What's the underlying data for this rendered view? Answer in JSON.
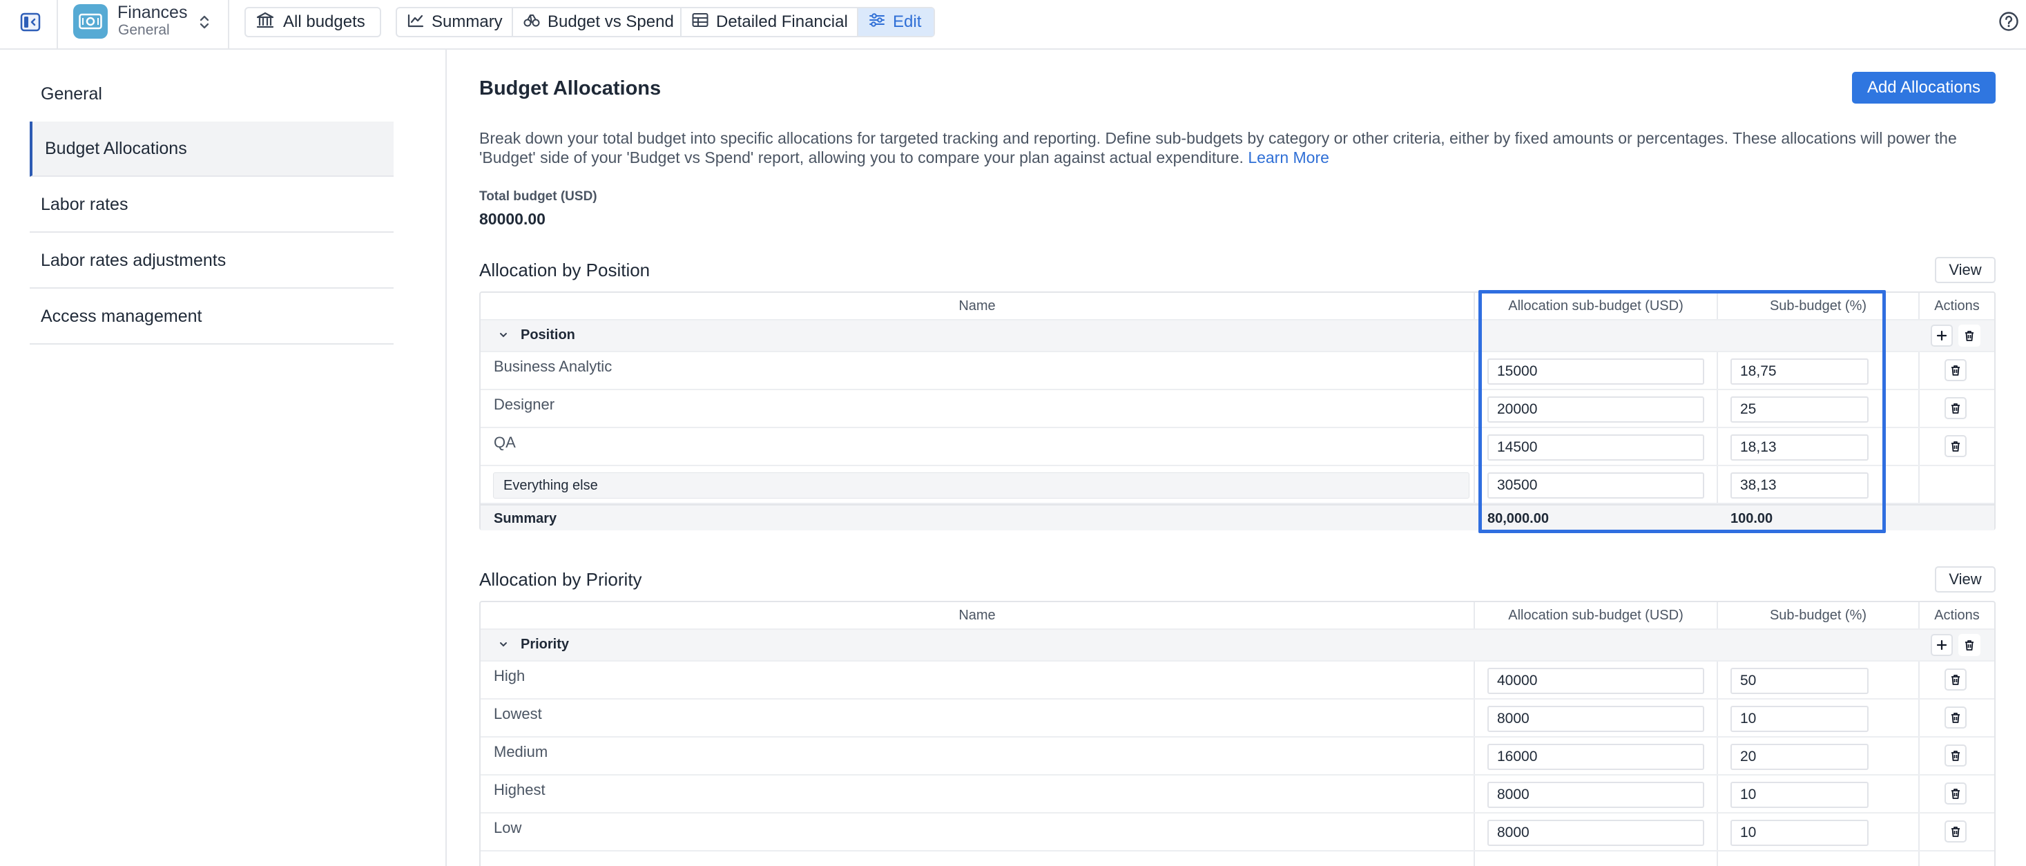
{
  "header": {
    "app_name": "Finances",
    "app_sub": "General",
    "all_budgets": "All budgets",
    "tabs": [
      {
        "label": "Summary",
        "icon": "chart-icon"
      },
      {
        "label": "Budget vs Spend",
        "icon": "scale-icon"
      },
      {
        "label": "Detailed Financial",
        "icon": "table-icon"
      },
      {
        "label": "Edit",
        "icon": "sliders-icon",
        "active": true
      }
    ]
  },
  "sidebar": {
    "items": [
      {
        "label": "General"
      },
      {
        "label": "Budget Allocations",
        "active": true
      },
      {
        "label": "Labor rates"
      },
      {
        "label": "Labor rates adjustments"
      },
      {
        "label": "Access management"
      }
    ]
  },
  "page": {
    "title": "Budget Allocations",
    "add_button": "Add Allocations",
    "description": "Break down your total budget into specific allocations for targeted tracking and reporting. Define sub-budgets by category or other criteria, either by fixed amounts or percentages. These allocations will power the 'Budget' side of your 'Budget vs Spend' report, allowing you to compare your plan against actual expenditure.",
    "learn_more": "Learn More",
    "total_label": "Total budget (USD)",
    "total_value": "80000.00"
  },
  "columns": {
    "name": "Name",
    "usd": "Allocation sub-budget (USD)",
    "pct": "Sub-budget (%)",
    "actions": "Actions"
  },
  "position": {
    "title": "Allocation by Position",
    "view": "View",
    "group": "Position",
    "rows": [
      {
        "name": "Business Analytic",
        "usd": "15000",
        "pct": "18,75"
      },
      {
        "name": "Designer",
        "usd": "20000",
        "pct": "25"
      },
      {
        "name": "QA",
        "usd": "14500",
        "pct": "18,13"
      }
    ],
    "else_row": {
      "name": "Everything else",
      "usd": "30500",
      "pct": "38,13"
    },
    "summary": {
      "label": "Summary",
      "usd": "80,000.00",
      "pct": "100.00"
    }
  },
  "priority": {
    "title": "Allocation by Priority",
    "view": "View",
    "group": "Priority",
    "rows": [
      {
        "name": "High",
        "usd": "40000",
        "pct": "50"
      },
      {
        "name": "Lowest",
        "usd": "8000",
        "pct": "10"
      },
      {
        "name": "Medium",
        "usd": "16000",
        "pct": "20"
      },
      {
        "name": "Highest",
        "usd": "8000",
        "pct": "10"
      },
      {
        "name": "Low",
        "usd": "8000",
        "pct": "10"
      }
    ]
  },
  "colors": {
    "accent": "#2f76e0",
    "highlight": "#2f6ee0",
    "app_icon": "#56aad4"
  }
}
